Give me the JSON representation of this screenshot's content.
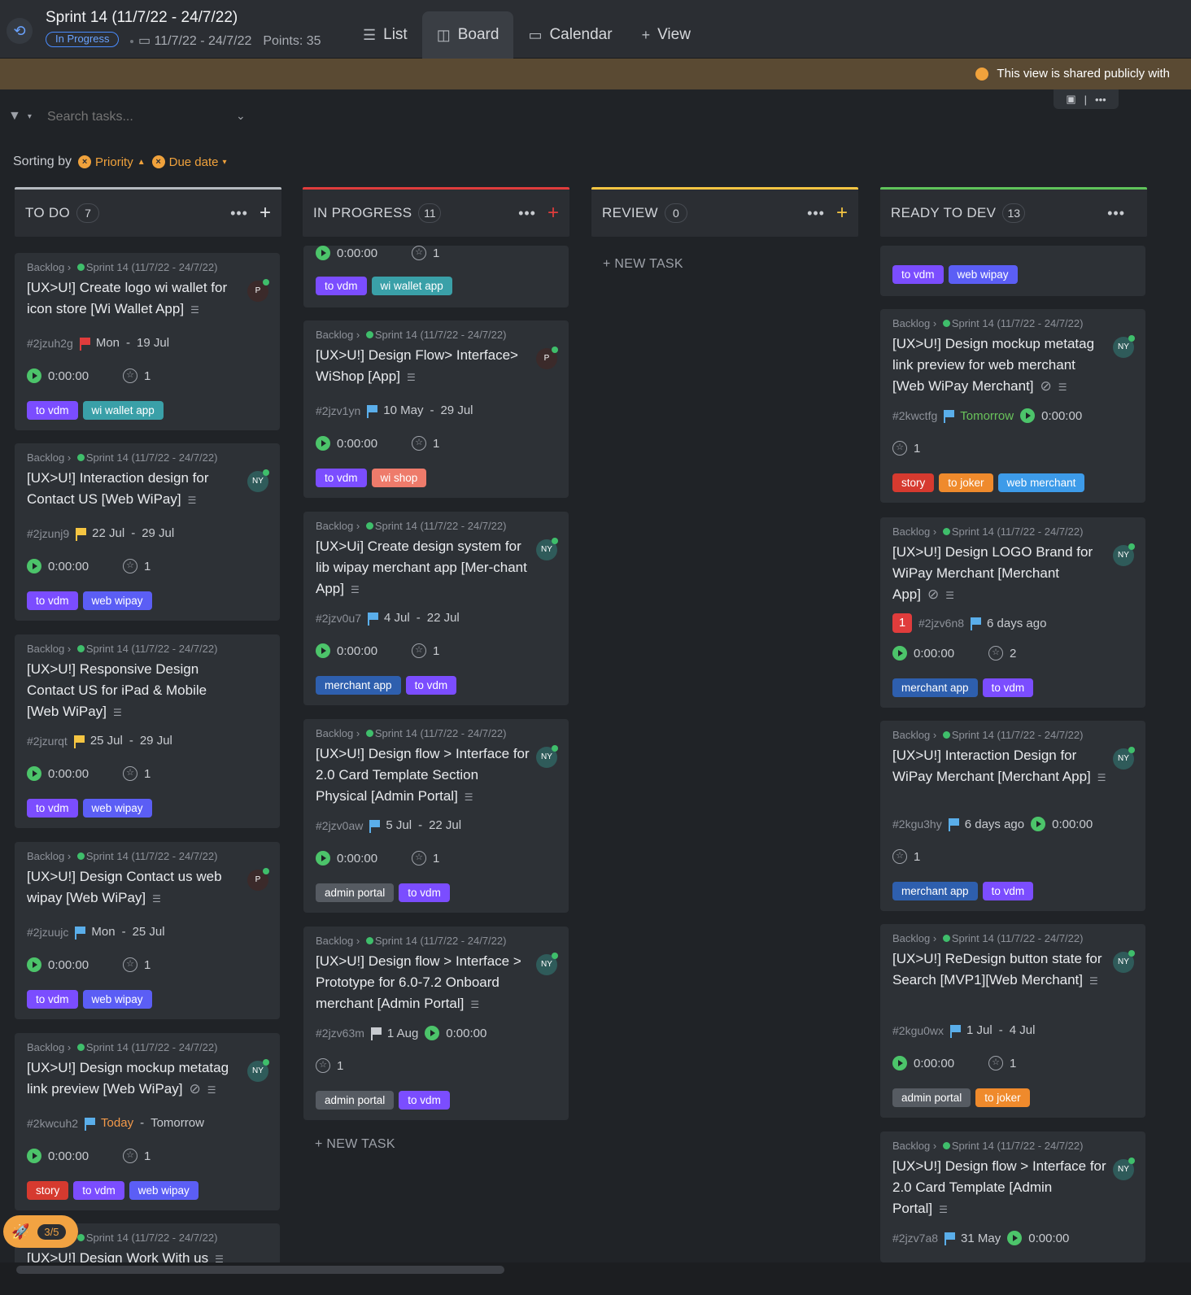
{
  "header": {
    "title": "Sprint 14 (11/7/22 - 24/7/22)",
    "status": "In Progress",
    "dates": "11/7/22 - 24/7/22",
    "points": "Points: 35"
  },
  "views": [
    {
      "label": "List"
    },
    {
      "label": "Board"
    },
    {
      "label": "Calendar"
    },
    {
      "label": "View"
    }
  ],
  "banner": {
    "text": "This view is shared publicly with"
  },
  "search": {
    "placeholder": "Search tasks..."
  },
  "sorting": {
    "label": "Sorting by",
    "chips": [
      "Priority",
      "Due date"
    ]
  },
  "new_task_label": "+ NEW TASK",
  "columns": [
    {
      "name": "TO DO",
      "count": "7"
    },
    {
      "name": "IN PROGRESS",
      "count": "11"
    },
    {
      "name": "REVIEW",
      "count": "0"
    },
    {
      "name": "READY TO DEV",
      "count": "13"
    }
  ],
  "crumb": {
    "backlog": "Backlog",
    "sprint": "Sprint 14 (11/7/22 - 24/7/22)"
  },
  "time": "0:00:00",
  "todo": [
    {
      "title": "[UX>U!] Create logo wi wallet for icon store [Wi Wallet App]",
      "avatar": "P",
      "id": "#2jzuh2g",
      "start": "Mon",
      "due": "19 Jul",
      "points": "1",
      "tags": [
        "to vdm",
        "wi wallet app"
      ]
    },
    {
      "title": "[UX>U!] Interaction design for Contact US [Web WiPay]",
      "avatar": "NY",
      "id": "#2jzunj9",
      "start": "22 Jul",
      "due": "29 Jul",
      "points": "1",
      "tags": [
        "to vdm",
        "web wipay"
      ]
    },
    {
      "title": "[UX>U!] Responsive Design Contact US for iPad & Mobile [Web WiPay]",
      "avatar": "",
      "id": "#2jzurqt",
      "start": "25 Jul",
      "due": "29 Jul",
      "points": "1",
      "tags": [
        "to vdm",
        "web wipay"
      ]
    },
    {
      "title": "[UX>U!] Design Contact us web wipay [Web WiPay]",
      "avatar": "P",
      "id": "#2jzuujc",
      "start": "Mon",
      "due": "25 Jul",
      "points": "1",
      "tags": [
        "to vdm",
        "web wipay"
      ]
    },
    {
      "title": "[UX>U!] Design mockup metatag link preview [Web WiPay]",
      "avatar": "NY",
      "id": "#2kwcuh2",
      "start": "Today",
      "due": "Tomorrow",
      "points": "1",
      "tags": [
        "story",
        "to vdm",
        "web wipay"
      ]
    },
    {
      "title": "[UX>U!] Design Work With us"
    }
  ],
  "inprogress_top": {
    "points": "1",
    "tags": [
      "to vdm",
      "wi wallet app"
    ]
  },
  "inprogress": [
    {
      "title": "[UX>U!] Design Flow> Interface> WiShop [App]",
      "avatar": "P",
      "id": "#2jzv1yn",
      "start": "10 May",
      "due": "29 Jul",
      "points": "1",
      "tags": [
        "to vdm",
        "wi shop"
      ]
    },
    {
      "title": "[UX>Ui] Create design system for lib wipay merchant app [Mer-chant App]",
      "avatar": "NY",
      "id": "#2jzv0u7",
      "start": "4 Jul",
      "due": "22 Jul",
      "points": "1",
      "tags": [
        "merchant app",
        "to vdm"
      ]
    },
    {
      "title": "[UX>U!] Design flow > Interface for 2.0 Card Template Section Physical [Admin Portal]",
      "avatar": "NY",
      "id": "#2jzv0aw",
      "start": "5 Jul",
      "due": "22 Jul",
      "points": "1",
      "tags": [
        "admin portal",
        "to vdm"
      ]
    },
    {
      "title": "[UX>U!] Design flow > Interface > Prototype for 6.0-7.2 Onboard merchant [Admin Portal]",
      "avatar": "NY",
      "id": "#2jzv63m",
      "start": "1 Aug",
      "points": "1",
      "tags": [
        "admin portal",
        "to vdm"
      ]
    }
  ],
  "ready_top": {
    "tags": [
      "to vdm",
      "web wipay"
    ]
  },
  "ready": [
    {
      "title": "[UX>U!] Design mockup metatag link preview for web merchant [Web WiPay Merchant]",
      "avatar": "NY",
      "id": "#2kwctfg",
      "due": "Tomorrow",
      "points": "1",
      "tags": [
        "story",
        "to joker",
        "web merchant"
      ]
    },
    {
      "title": "[UX>U!] Design LOGO Brand for WiPay Merchant [Merchant App]",
      "avatar": "NY",
      "badge": "1",
      "id": "#2jzv6n8",
      "due": "6 days ago",
      "points": "2",
      "tags": [
        "merchant app",
        "to vdm"
      ]
    },
    {
      "title": "[UX>U!] Interaction Design for WiPay Merchant [Merchant App]",
      "avatar": "NY",
      "id": "#2kgu3hy",
      "due": "6 days ago",
      "points": "1",
      "tags": [
        "merchant app",
        "to vdm"
      ]
    },
    {
      "title": "[UX>U!] ReDesign button state for Search [MVP1][Web Merchant]",
      "avatar": "NY",
      "id": "#2kgu0wx",
      "start": "1 Jul",
      "due": "4 Jul",
      "points": "1",
      "tags": [
        "admin portal",
        "to joker"
      ]
    },
    {
      "title": "[UX>U!] Design flow > Interface for 2.0 Card Template [Admin Portal]",
      "avatar": "NY",
      "id": "#2jzv7a8",
      "start": "31 May"
    }
  ],
  "rocket": {
    "progress": "3/5"
  },
  "colors": {
    "to vdm": "#7b4dff",
    "wi wallet app": "#3aa0a8",
    "web wipay": "#5b5ef5",
    "wi shop": "#ee7b6b",
    "merchant app": "#2e5fae",
    "admin portal": "#565b62",
    "story": "#d63a2f",
    "to joker": "#ef8a2c",
    "web merchant": "#3d9be9"
  }
}
